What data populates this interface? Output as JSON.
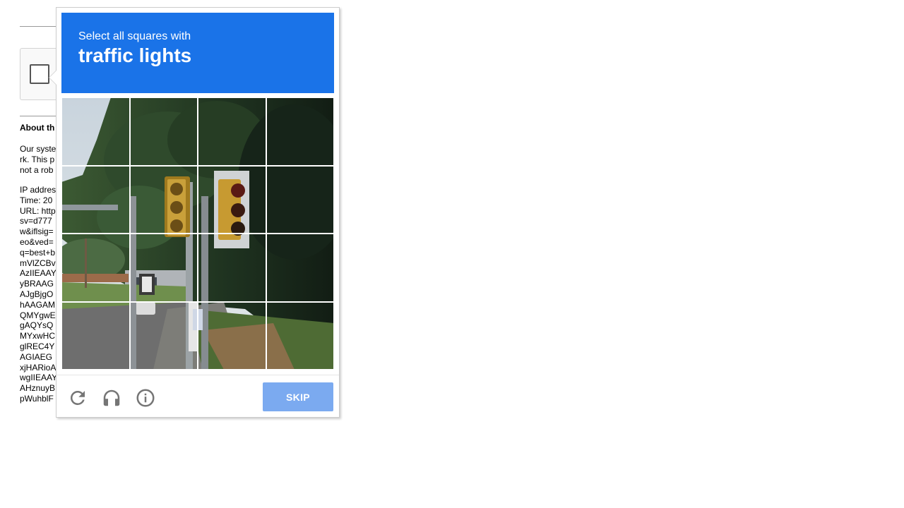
{
  "background_page": {
    "about_title": "About th",
    "paragraph1": [
      "Our syste",
      "rk. This p",
      "not a rob"
    ],
    "paragraph2": [
      "IP addres",
      "Time: 20",
      "URL: http",
      "sv=d777",
      "w&iflsig=",
      "eo&ved=",
      "q=best+b",
      "mVlZCBv",
      "AzIIEAAY",
      "yBRAAG",
      "AJgBjgO",
      "hAAGAM",
      "QMYgwE",
      "gAQYsQ",
      "MYxwHC",
      "glREC4Y",
      "AGIAEG",
      "xjHARioA",
      "wgIIEAAY",
      "AHznuyB",
      "pWuhblF"
    ]
  },
  "challenge": {
    "instruction_prefix": "Select all squares with",
    "target_object": "traffic lights",
    "header_color": "#1a73e8",
    "grid_size": "4x4",
    "skip_label": "SKIP",
    "skip_color": "#7baaf0",
    "icons": [
      "reload-icon",
      "headphones-icon",
      "info-icon"
    ]
  }
}
